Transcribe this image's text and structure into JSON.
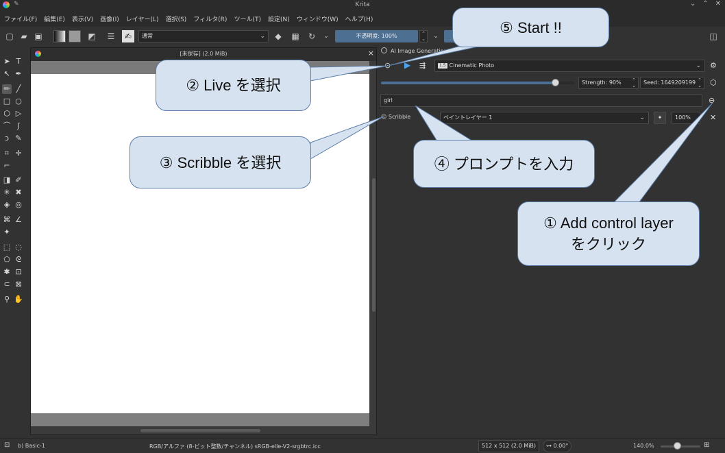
{
  "window": {
    "title": "Krita"
  },
  "menu": [
    "ファイル(F)",
    "編集(E)",
    "表示(V)",
    "画像(I)",
    "レイヤー(L)",
    "選択(S)",
    "フィルタ(R)",
    "ツール(T)",
    "設定(N)",
    "ウィンドウ(W)",
    "ヘルプ(H)"
  ],
  "toolbar": {
    "blend_mode": "通常",
    "opacity": "不透明度: 100%"
  },
  "document": {
    "title": "[未保存]  (2.0 MiB)"
  },
  "ai": {
    "docker_title": "AI Image Generation",
    "style": "Cinematic Photo",
    "style_badge": "1.5",
    "strength": "Strength: 90%",
    "strength_value": 0.9,
    "seed": "Seed: 1649209199",
    "prompt": "girl",
    "control_type": "Scribble",
    "control_layer": "ペイントレイヤー 1",
    "control_strength": "100%"
  },
  "status": {
    "brush": "b) Basic-1",
    "color_space": "RGB/アルファ (8-ビット整数/チャンネル)  sRGB-elle-V2-srgbtrc.icc",
    "image_size": "512 x 512 (2.0 MiB)",
    "rotation": "0.00°",
    "zoom": "140.0%"
  },
  "callouts": {
    "start": "⑤ Start !!",
    "live": "② Live を選択",
    "scribble": "③ Scribble を選択",
    "prompt": "④ プロンプトを入力",
    "control_line1": "① Add control layer",
    "control_line2": "をクリック"
  },
  "colors": {
    "accent": "#4d6f92",
    "callout_fill": "#d6e2ef",
    "callout_border": "#5b7da6",
    "play": "#4ea3f0"
  }
}
